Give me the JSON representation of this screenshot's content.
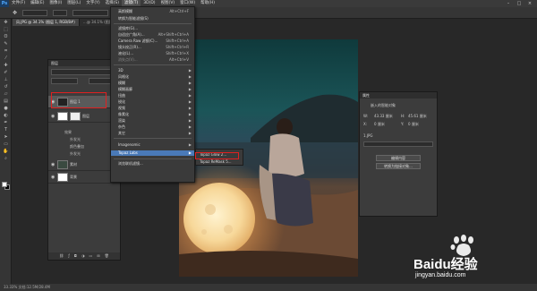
{
  "menubar": {
    "logo": "Ps",
    "items": [
      "文件(F)",
      "编辑(E)",
      "图像(I)",
      "图层(L)",
      "文字(Y)",
      "选择(S)",
      "滤镜(T)",
      "3D(D)",
      "视图(V)",
      "窗口(W)",
      "帮助(H)"
    ]
  },
  "tabs": [
    "风.JPG @ 34.1% (图层 1, RGB/8#)",
    "…@ 34.1% (图层 1, RGB/8#)"
  ],
  "layers_panel": {
    "title": "图层",
    "rows": [
      {
        "name": "图层 1"
      },
      {
        "name": "图层"
      },
      {
        "name": "效果"
      },
      {
        "name": "外发光"
      },
      {
        "name": "颜色叠加"
      },
      {
        "name": "外发光"
      },
      {
        "name": "素材"
      },
      {
        "name": "背景"
      }
    ]
  },
  "filter_menu": {
    "items": [
      {
        "label": "高斯模糊",
        "shortcut": "Alt+Ctrl+F"
      },
      {
        "label": "转换为智能滤镜(S)",
        "shortcut": ""
      },
      {
        "label": "滤镜库(G)...",
        "shortcut": ""
      },
      {
        "label": "自适应广角(A)...",
        "shortcut": "Alt+Shift+Ctrl+A"
      },
      {
        "label": "Camera Raw 滤镜(C)...",
        "shortcut": "Shift+Ctrl+A"
      },
      {
        "label": "镜头校正(R)...",
        "shortcut": "Shift+Ctrl+R"
      },
      {
        "label": "液化(L)...",
        "shortcut": "Shift+Ctrl+X"
      },
      {
        "label": "消失点(V)...",
        "shortcut": "Alt+Ctrl+V"
      },
      {
        "label": "3D",
        "shortcut": ""
      },
      {
        "label": "风格化",
        "shortcut": ""
      },
      {
        "label": "模糊",
        "shortcut": ""
      },
      {
        "label": "模糊画廊",
        "shortcut": ""
      },
      {
        "label": "扭曲",
        "shortcut": ""
      },
      {
        "label": "锐化",
        "shortcut": ""
      },
      {
        "label": "视频",
        "shortcut": ""
      },
      {
        "label": "像素化",
        "shortcut": ""
      },
      {
        "label": "渲染",
        "shortcut": ""
      },
      {
        "label": "杂色",
        "shortcut": ""
      },
      {
        "label": "其它",
        "shortcut": ""
      },
      {
        "label": "Imagenomic",
        "shortcut": ""
      },
      {
        "label": "Topaz Labs",
        "shortcut": ""
      },
      {
        "label": "浏览联机滤镜...",
        "shortcut": ""
      }
    ]
  },
  "submenu": {
    "items": [
      "Topaz Glow 2...",
      "Topaz ReMask 5..."
    ]
  },
  "properties_panel": {
    "title": "属性",
    "subtitle": "嵌入的智能对象",
    "w_label": "W:",
    "w_value": "43.33 厘米",
    "h_label": "H:",
    "h_value": "45.61 厘米",
    "x_label": "X:",
    "x_value": "0 厘米",
    "y_label": "Y:",
    "y_value": "0 厘米",
    "file": "1.JPG",
    "btn1": "编辑内容",
    "btn2": "转换为链接对象..."
  },
  "status": {
    "text": "33.33%    文档:12.5M/28.4M"
  },
  "watermark": {
    "brand": "Baidu经验",
    "url": "jingyan.baidu.com"
  },
  "colors": {
    "menu_highlight": "#4a7ab8",
    "callout": "#e02020"
  }
}
